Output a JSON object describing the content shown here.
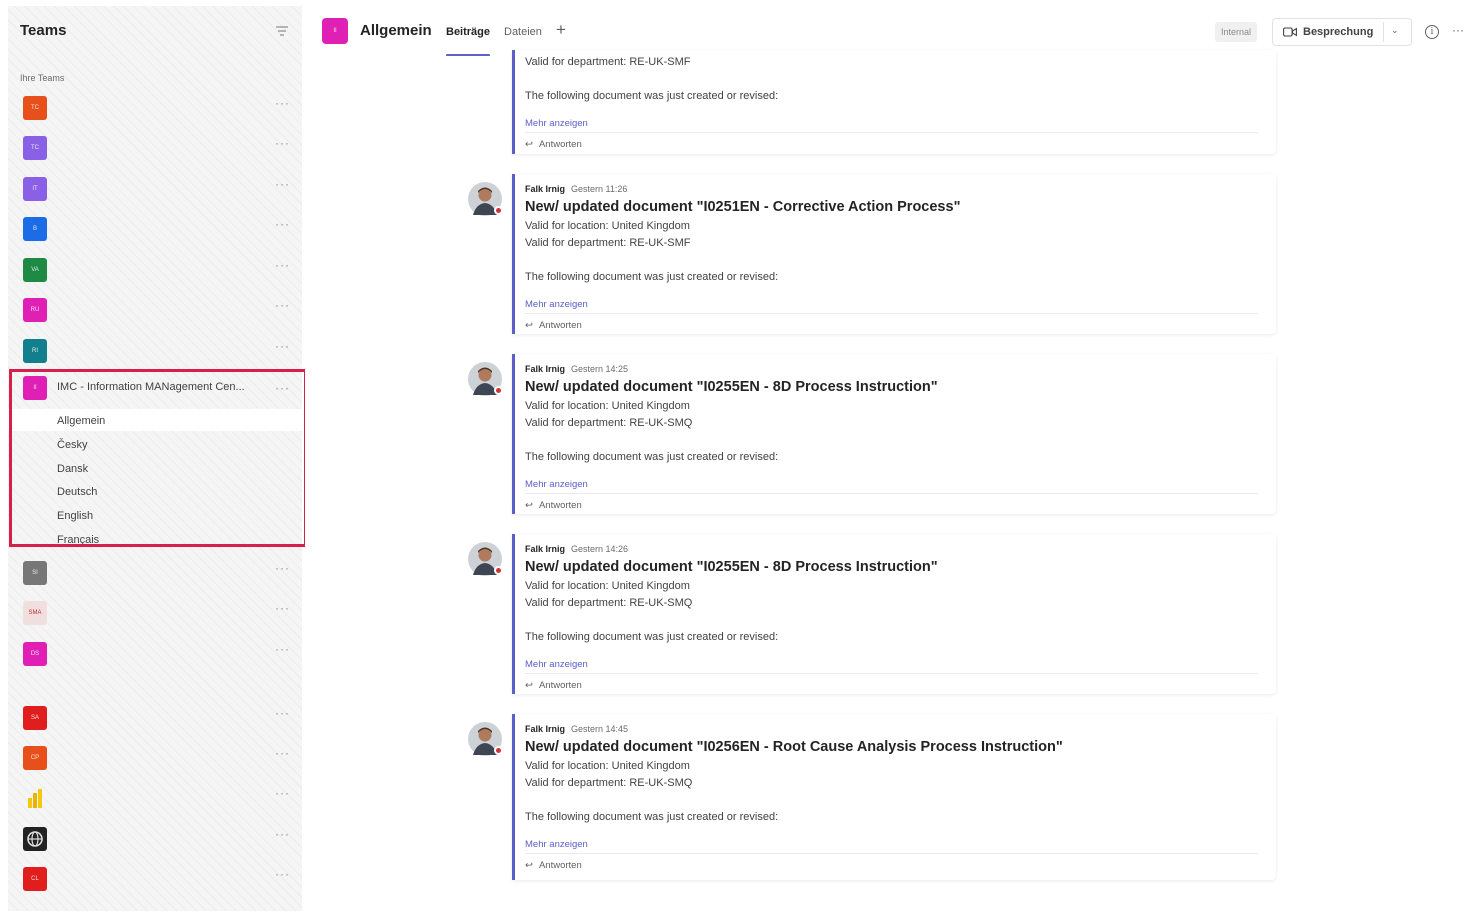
{
  "sidebar": {
    "title": "Teams",
    "section_label": "Ihre Teams",
    "teams": [
      {
        "initials": "TC",
        "color": "#e8501b"
      },
      {
        "initials": "TC",
        "color": "#8a60e6"
      },
      {
        "initials": "IT",
        "color": "#8a60e6"
      },
      {
        "initials": "B",
        "color": "#1c6ce8"
      },
      {
        "initials": "VA",
        "color": "#1e8a43"
      },
      {
        "initials": "RU",
        "color": "#e020b4"
      },
      {
        "initials": "RI",
        "color": "#12808c"
      }
    ],
    "selected_team": {
      "initials": "II",
      "color": "#e020b4",
      "name": "IMC - Information MANagement Cen...",
      "channels": [
        "Allgemein",
        "Česky",
        "Dansk",
        "Deutsch",
        "English",
        "Français"
      ]
    },
    "more_teams": [
      {
        "initials": "SI",
        "color": "#777777"
      },
      {
        "initials": "SMA",
        "color": "#f1dede"
      },
      {
        "initials": "DS",
        "color": "#e020b4"
      },
      {
        "initials": "SA",
        "color": "#e11e1e"
      },
      {
        "initials": "CP",
        "color": "#e8501b"
      },
      {
        "initials": "",
        "color": "#f2c811"
      },
      {
        "initials": "",
        "color": "#222222"
      },
      {
        "initials": "CL",
        "color": "#e11e1e"
      }
    ],
    "more_label": "···"
  },
  "header": {
    "channel_initials": "II",
    "channel_color": "#e020b4",
    "channel_name": "Allgemein",
    "tabs": {
      "posts": "Beiträge",
      "files": "Dateien"
    },
    "add_tab": "+",
    "internal_label": "Internal",
    "meeting_label": "Besprechung",
    "info": "i",
    "more": "···"
  },
  "feed": {
    "partial_post": {
      "department": "Valid for department: RE-UK-SMF",
      "body": "The following document was just created or revised:",
      "show_more": "Mehr anzeigen",
      "reply": "Antworten"
    },
    "posts": [
      {
        "author": "Falk Irnig",
        "time": "Gestern 11:26",
        "title": "New/ updated document \"I0251EN - Corrective Action Process\"",
        "location": "Valid for location: United Kingdom",
        "department": "Valid for department: RE-UK-SMF",
        "body": "The following document was just created or revised:",
        "show_more": "Mehr anzeigen",
        "reply": "Antworten"
      },
      {
        "author": "Falk Irnig",
        "time": "Gestern 14:25",
        "title": "New/ updated document \"I0255EN - 8D Process Instruction\"",
        "location": "Valid for location: United Kingdom",
        "department": "Valid for department: RE-UK-SMQ",
        "body": "The following document was just created or revised:",
        "show_more": "Mehr anzeigen",
        "reply": "Antworten"
      },
      {
        "author": "Falk Irnig",
        "time": "Gestern 14:26",
        "title": "New/ updated document \"I0255EN - 8D Process Instruction\"",
        "location": "Valid for location: United Kingdom",
        "department": "Valid for department: RE-UK-SMQ",
        "body": "The following document was just created or revised:",
        "show_more": "Mehr anzeigen",
        "reply": "Antworten"
      },
      {
        "author": "Falk Irnig",
        "time": "Gestern 14:45",
        "title": "New/ updated document \"I0256EN - Root Cause Analysis Process Instruction\"",
        "location": "Valid for location: United Kingdom",
        "department": "Valid for department: RE-UK-SMQ",
        "body": "The following document was just created or revised:",
        "show_more": "Mehr anzeigen",
        "reply": "Antworten"
      }
    ]
  }
}
